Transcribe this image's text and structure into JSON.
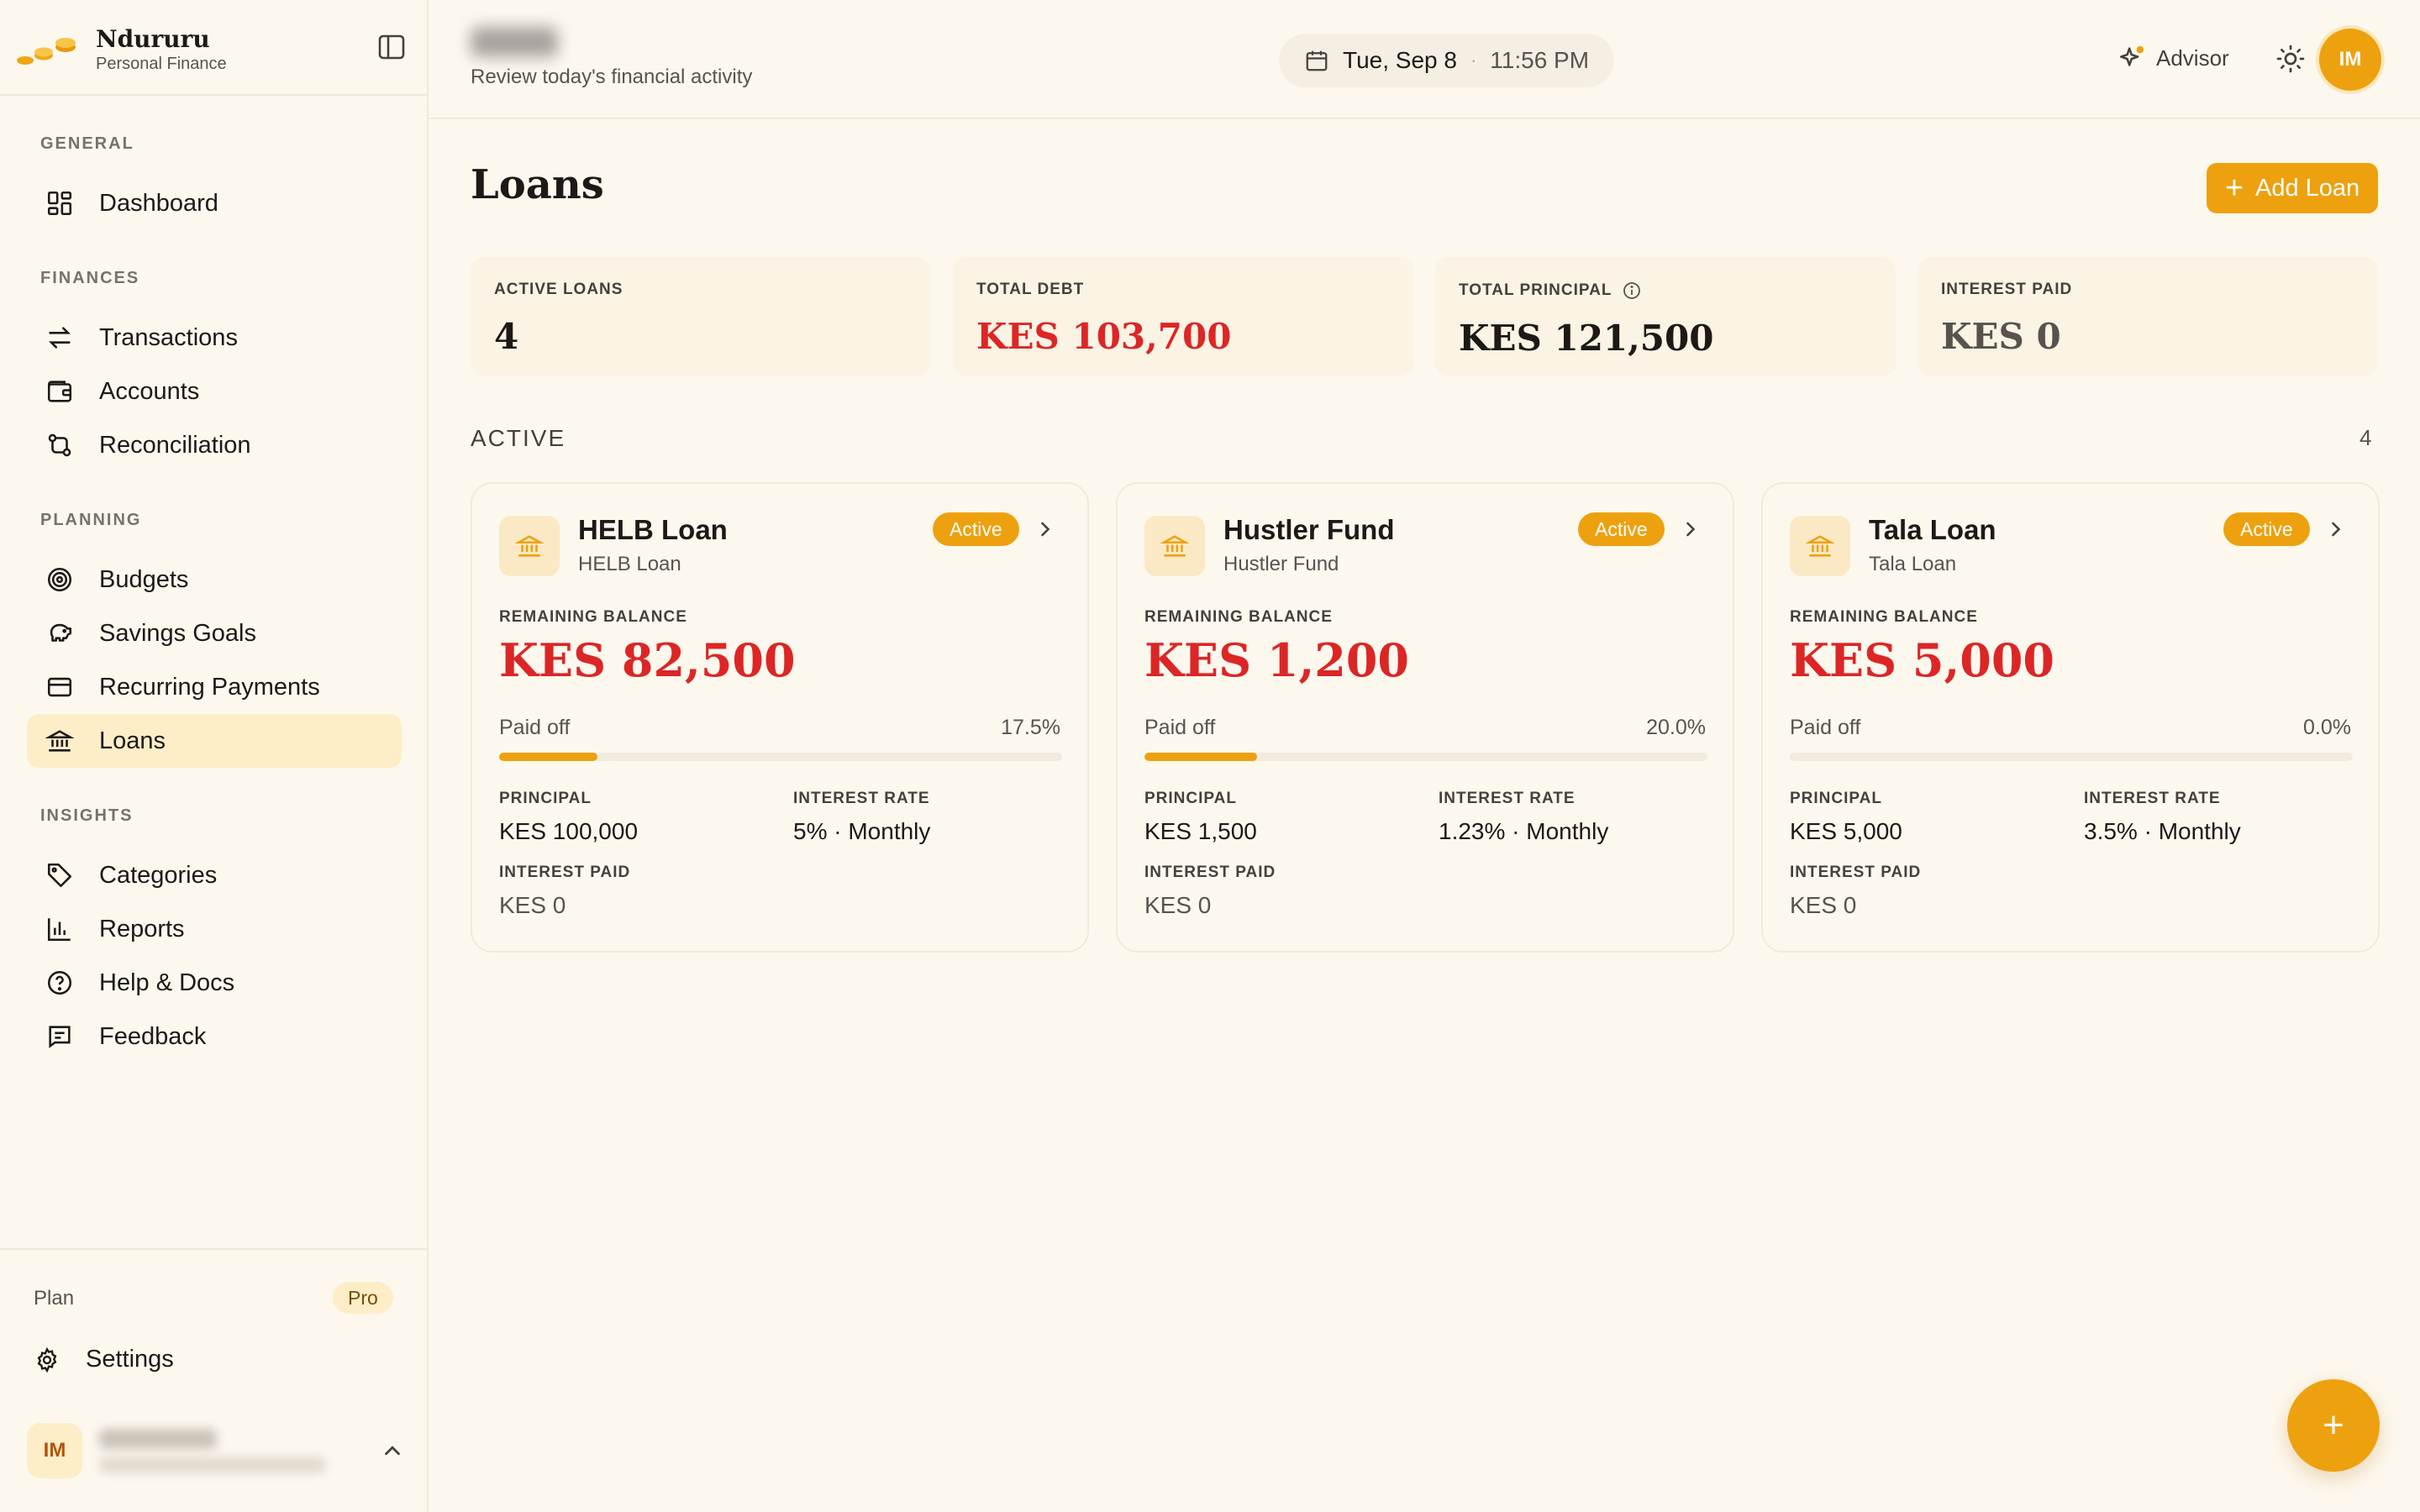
{
  "brand": {
    "name": "Ndururu",
    "subtitle": "Personal Finance"
  },
  "sidebar": {
    "sections": [
      {
        "title": "GENERAL",
        "items": [
          {
            "label": "Dashboard",
            "icon": "dashboard-icon"
          }
        ]
      },
      {
        "title": "FINANCES",
        "items": [
          {
            "label": "Transactions",
            "icon": "arrows-icon"
          },
          {
            "label": "Accounts",
            "icon": "wallet-icon"
          },
          {
            "label": "Reconciliation",
            "icon": "reconcile-icon"
          }
        ]
      },
      {
        "title": "PLANNING",
        "items": [
          {
            "label": "Budgets",
            "icon": "target-icon"
          },
          {
            "label": "Savings Goals",
            "icon": "piggy-bank-icon"
          },
          {
            "label": "Recurring Payments",
            "icon": "card-icon"
          },
          {
            "label": "Loans",
            "icon": "bank-icon",
            "active": true
          }
        ]
      },
      {
        "title": "INSIGHTS",
        "items": [
          {
            "label": "Categories",
            "icon": "tag-icon"
          },
          {
            "label": "Reports",
            "icon": "bar-chart-icon"
          },
          {
            "label": "Help & Docs",
            "icon": "help-icon"
          },
          {
            "label": "Feedback",
            "icon": "message-icon"
          }
        ]
      }
    ],
    "plan_label": "Plan",
    "plan_badge": "Pro",
    "settings_label": "Settings",
    "user_initials": "IM"
  },
  "header": {
    "greeting_sub": "Review today's financial activity",
    "date": "Tue, Sep 8",
    "time": "11:56 PM",
    "advisor_label": "Advisor",
    "avatar_initials": "IM"
  },
  "page": {
    "title": "Loans",
    "add_button": "Add Loan",
    "plus_glyph": "+",
    "stats": [
      {
        "label": "ACTIVE LOANS",
        "value": "4",
        "color": "#1c1917"
      },
      {
        "label": "TOTAL DEBT",
        "value": "KES 103,700",
        "color": "#dc2626"
      },
      {
        "label": "TOTAL PRINCIPAL",
        "value": "KES 121,500",
        "color": "#1c1917",
        "info": true
      },
      {
        "label": "INTEREST PAID",
        "value": "KES 0",
        "color": "#57534e"
      }
    ],
    "section_title": "ACTIVE",
    "section_count": "4"
  },
  "loan_labels": {
    "remaining": "REMAINING BALANCE",
    "paid_off": "Paid off",
    "principal": "PRINCIPAL",
    "interest_rate": "INTEREST RATE",
    "interest_paid": "INTEREST PAID"
  },
  "loans": [
    {
      "name": "HELB Loan",
      "subtitle": "HELB Loan",
      "status": "Active",
      "balance": "KES 82,500",
      "paid_pct": "17.5%",
      "paid_fraction": 0.175,
      "principal": "KES 100,000",
      "rate": "5% · Monthly",
      "interest_paid": "KES 0"
    },
    {
      "name": "Hustler Fund",
      "subtitle": "Hustler Fund",
      "status": "Active",
      "balance": "KES 1,200",
      "paid_pct": "20.0%",
      "paid_fraction": 0.2,
      "principal": "KES 1,500",
      "rate": "1.23% · Monthly",
      "interest_paid": "KES 0"
    },
    {
      "name": "Tala Loan",
      "subtitle": "Tala Loan",
      "status": "Active",
      "balance": "KES 5,000",
      "paid_pct": "0.0%",
      "paid_fraction": 0.0,
      "principal": "KES 5,000",
      "rate": "3.5% · Monthly",
      "interest_paid": "KES 0"
    }
  ],
  "fab_glyph": "+",
  "colors": {
    "accent": "#eea10e",
    "danger": "#dc2626",
    "active_nav": "#fdeec8"
  }
}
